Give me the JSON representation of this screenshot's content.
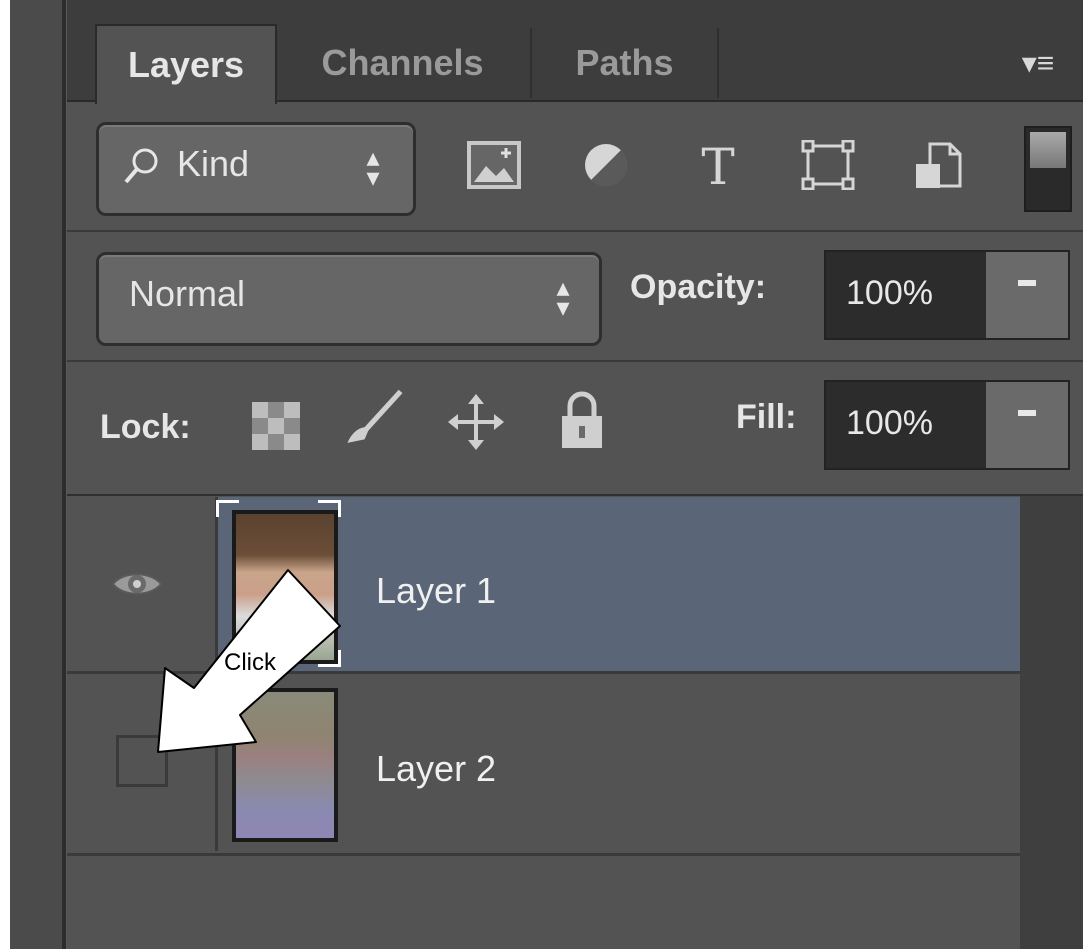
{
  "panel_tabs": [
    {
      "label": "Layers",
      "active": true
    },
    {
      "label": "Channels",
      "active": false
    },
    {
      "label": "Paths",
      "active": false
    }
  ],
  "panel_menu_icon": "panel-menu-icon",
  "filter": {
    "kind_label": "Kind",
    "icons": [
      "pixel-layer-filter-icon",
      "adjustment-layer-filter-icon",
      "type-layer-filter-icon",
      "shape-layer-filter-icon",
      "smart-object-filter-icon"
    ],
    "type_glyph": "T"
  },
  "blend": {
    "mode": "Normal",
    "opacity_label": "Opacity:",
    "opacity_value": "100%"
  },
  "lock": {
    "label": "Lock:",
    "icons": [
      "lock-transparent-pixels-icon",
      "lock-image-pixels-icon",
      "lock-position-icon",
      "lock-all-icon"
    ],
    "fill_label": "Fill:",
    "fill_value": "100%"
  },
  "layers": [
    {
      "name": "Layer 1",
      "visible": true,
      "selected": true
    },
    {
      "name": "Layer 2",
      "visible": false,
      "selected": false
    }
  ],
  "callout": {
    "text": "Click"
  },
  "colors": {
    "panel_bg": "#535353",
    "selected_row": "#5b6578",
    "tab_bar": "#3d3d3d"
  }
}
